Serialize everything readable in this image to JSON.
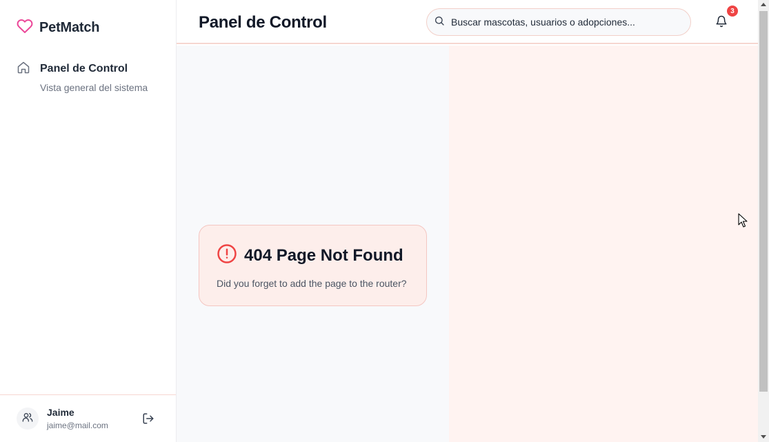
{
  "app": {
    "name": "PetMatch"
  },
  "sidebar": {
    "items": [
      {
        "label": "Panel de Control",
        "sublabel": "Vista general del sistema",
        "icon": "home-icon"
      }
    ],
    "user": {
      "name": "Jaime",
      "email": "jaime@mail.com"
    }
  },
  "header": {
    "title": "Panel de Control",
    "search": {
      "placeholder": "Buscar mascotas, usuarios o adopciones..."
    },
    "notifications": {
      "count": "3"
    }
  },
  "error_card": {
    "title": "404 Page Not Found",
    "message": "Did you forget to add the page to the router?"
  },
  "colors": {
    "brand": "#ec4899",
    "danger": "#ef4444",
    "main_bg": "#f8f9fb",
    "accent_bg": "#fff3f1"
  }
}
